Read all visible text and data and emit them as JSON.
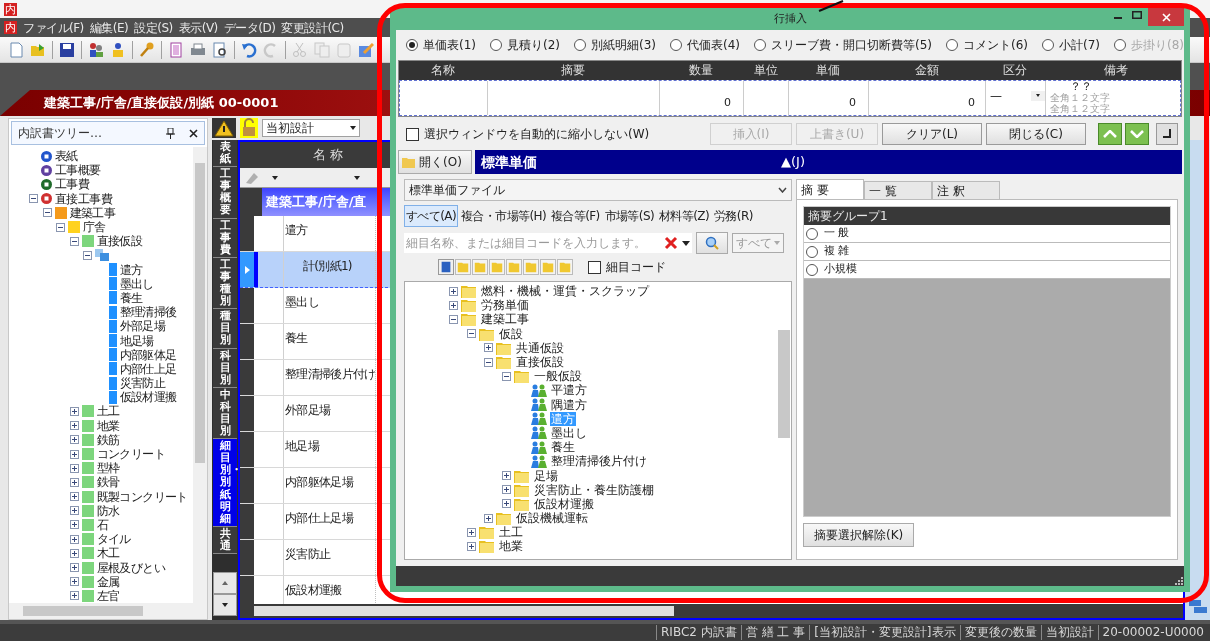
{
  "app": {
    "window_icon_text": "内",
    "menu_icon_text": "内",
    "menu": [
      "ファイル(F)",
      "編集(E)",
      "設定(S)",
      "表示(V)",
      "データ(D)",
      "変更設計(C)"
    ]
  },
  "breadcrumb_banner": "建築工事/庁舎/直接仮設/別紙 00-0001",
  "tree_panel": {
    "title": "内訳書ツリー…",
    "nodes": [
      {
        "label": "表紙",
        "kind": "badge",
        "color": "#2255cc"
      },
      {
        "label": "工事概要",
        "kind": "badge",
        "color": "#6040a0"
      },
      {
        "label": "工事費",
        "kind": "badge",
        "color": "#1f6b2a"
      },
      {
        "label": "直接工事費",
        "kind": "badge",
        "color": "#d03030",
        "expanded": true,
        "children": [
          {
            "label": "建築工事",
            "kind": "page",
            "color": "#f59a1b",
            "expanded": true,
            "children": [
              {
                "label": "庁舎",
                "kind": "page",
                "color": "#ffd21f",
                "expanded": true,
                "children": [
                  {
                    "label": "直接仮設",
                    "kind": "page",
                    "color": "#7dd67d",
                    "expanded": true,
                    "children": [
                      {
                        "kind": "group",
                        "color": "#3b8fe0",
                        "expanded": true,
                        "children": [
                          {
                            "label": "遣方",
                            "kind": "sheet",
                            "color": "#1e90ff"
                          },
                          {
                            "label": "墨出し",
                            "kind": "sheet",
                            "color": "#1e90ff"
                          },
                          {
                            "label": "養生",
                            "kind": "sheet",
                            "color": "#1e90ff"
                          },
                          {
                            "label": "整理清掃後",
                            "kind": "sheet",
                            "color": "#1e90ff"
                          },
                          {
                            "label": "外部足場",
                            "kind": "sheet",
                            "color": "#1e90ff"
                          },
                          {
                            "label": "地足場",
                            "kind": "sheet",
                            "color": "#1e90ff"
                          },
                          {
                            "label": "内部躯体足",
                            "kind": "sheet",
                            "color": "#1e90ff"
                          },
                          {
                            "label": "内部仕上足",
                            "kind": "sheet",
                            "color": "#1e90ff"
                          },
                          {
                            "label": "災害防止",
                            "kind": "sheet",
                            "color": "#1e90ff"
                          },
                          {
                            "label": "仮設材運搬",
                            "kind": "sheet",
                            "color": "#1e90ff"
                          }
                        ]
                      }
                    ]
                  },
                  {
                    "label": "土工",
                    "kind": "page",
                    "color": "#7dd67d",
                    "expanded": false
                  },
                  {
                    "label": "地業",
                    "kind": "page",
                    "color": "#7dd67d",
                    "expanded": false
                  },
                  {
                    "label": "鉄筋",
                    "kind": "page",
                    "color": "#7dd67d",
                    "expanded": false
                  },
                  {
                    "label": "コンクリート",
                    "kind": "page",
                    "color": "#7dd67d",
                    "expanded": false
                  },
                  {
                    "label": "型枠",
                    "kind": "page",
                    "color": "#7dd67d",
                    "expanded": false
                  },
                  {
                    "label": "鉄骨",
                    "kind": "page",
                    "color": "#7dd67d",
                    "expanded": false
                  },
                  {
                    "label": "既製コンクリート",
                    "kind": "page",
                    "color": "#7dd67d",
                    "expanded": false
                  },
                  {
                    "label": "防水",
                    "kind": "page",
                    "color": "#7dd67d",
                    "expanded": false
                  },
                  {
                    "label": "石",
                    "kind": "page",
                    "color": "#7dd67d",
                    "expanded": false
                  },
                  {
                    "label": "タイル",
                    "kind": "page",
                    "color": "#7dd67d",
                    "expanded": false
                  },
                  {
                    "label": "木工",
                    "kind": "page",
                    "color": "#7dd67d",
                    "expanded": false
                  },
                  {
                    "label": "屋根及びとい",
                    "kind": "page",
                    "color": "#7dd67d",
                    "expanded": false
                  },
                  {
                    "label": "金属",
                    "kind": "page",
                    "color": "#7dd67d",
                    "expanded": false
                  },
                  {
                    "label": "左官",
                    "kind": "page",
                    "color": "#7dd67d",
                    "expanded": false
                  }
                ]
              }
            ]
          }
        ]
      }
    ]
  },
  "view_tabs": [
    {
      "label": "表紙",
      "selected": false
    },
    {
      "label": "工事概要",
      "selected": false
    },
    {
      "label": "工事費",
      "selected": false
    },
    {
      "label": "工事種別",
      "selected": false
    },
    {
      "label": "種目別",
      "selected": false
    },
    {
      "label": "科目別",
      "selected": false
    },
    {
      "label": "中科目別",
      "selected": false
    },
    {
      "label": "細目別・別紙明細",
      "selected": true
    },
    {
      "label": "共通",
      "selected": false
    }
  ],
  "sheet": {
    "design_mode": "当初設計",
    "column_header": "名 称",
    "group_row": "建築工事/庁舎/直",
    "rows": [
      {
        "name": "遣方",
        "selected": false
      },
      {
        "name": "計(別紙1)",
        "selected": true,
        "kind": "subtotal"
      },
      {
        "name": "墨出し",
        "selected": false
      },
      {
        "name": "養生",
        "selected": false
      },
      {
        "name": "整理清掃後片付け",
        "selected": false
      },
      {
        "name": "外部足場",
        "selected": false
      },
      {
        "name": "地足場",
        "selected": false
      },
      {
        "name": "内部躯体足場",
        "selected": false
      },
      {
        "name": "内部仕上足場",
        "selected": false
      },
      {
        "name": "災害防止",
        "selected": false
      },
      {
        "name": "仮設材運搬",
        "selected": false
      }
    ]
  },
  "insert_dialog": {
    "title": "行挿入",
    "row_types": [
      {
        "label": "単価表(1)",
        "selected": true,
        "disabled": false
      },
      {
        "label": "見積り(2)",
        "selected": false,
        "disabled": false
      },
      {
        "label": "別紙明細(3)",
        "selected": false,
        "disabled": false
      },
      {
        "label": "代価表(4)",
        "selected": false,
        "disabled": false
      },
      {
        "label": "スリーブ費・開口切断費等(5)",
        "selected": false,
        "disabled": false
      },
      {
        "label": "コメント(6)",
        "selected": false,
        "disabled": false
      },
      {
        "label": "小計(7)",
        "selected": false,
        "disabled": false
      },
      {
        "label": "歩掛り(8)",
        "selected": false,
        "disabled": true
      }
    ],
    "entry": {
      "columns": [
        "名称",
        "摘要",
        "数量",
        "単位",
        "単価",
        "金額",
        "区分",
        "備考"
      ],
      "quantity": "0",
      "unit_price": "0",
      "amount": "0",
      "category": "—",
      "remarks": "？？",
      "remark_hints": [
        "全角１２文字",
        "全角１２文字"
      ]
    },
    "auto_shrink_checkbox": {
      "label": "選択ウィンドウを自動的に縮小しない(W)",
      "checked": false
    },
    "buttons": [
      {
        "label": "挿入(I)",
        "disabled": true
      },
      {
        "label": "上書き(U)",
        "disabled": true
      },
      {
        "label": "クリア(L)",
        "disabled": false
      },
      {
        "label": "閉じる(C)",
        "disabled": false
      }
    ],
    "open_button": "開く(O)",
    "source_title": "標準単価",
    "collapse_label": "▲(J)",
    "file_select": "標準単価ファイル",
    "filter_tabs": [
      {
        "label": "すべて(A)",
        "selected": true
      },
      {
        "label": "複合・市場等(H)",
        "selected": false
      },
      {
        "label": "複合等(F)",
        "selected": false
      },
      {
        "label": "市場等(S)",
        "selected": false
      },
      {
        "label": "材料等(Z)",
        "selected": false
      },
      {
        "label": "労務(R)",
        "selected": false
      }
    ],
    "search": {
      "placeholder": "細目名称、または細目コードを入力します。",
      "scope": "すべて"
    },
    "code_checkbox": {
      "label": "細目コード",
      "checked": false
    },
    "tree": [
      {
        "label": "燃料・機械・運賃・スクラップ",
        "kind": "folder",
        "expanded": false
      },
      {
        "label": "労務単価",
        "kind": "folder",
        "expanded": false
      },
      {
        "label": "建築工事",
        "kind": "folder",
        "expanded": true,
        "children": [
          {
            "label": "仮設",
            "kind": "folder",
            "expanded": true,
            "children": [
              {
                "label": "共通仮設",
                "kind": "folder",
                "expanded": false
              },
              {
                "label": "直接仮設",
                "kind": "folder",
                "expanded": true,
                "children": [
                  {
                    "label": "一般仮設",
                    "kind": "folder",
                    "expanded": true,
                    "children": [
                      {
                        "label": "平遣方",
                        "kind": "item",
                        "selected": false
                      },
                      {
                        "label": "隅遣方",
                        "kind": "item",
                        "selected": false
                      },
                      {
                        "label": "遣方",
                        "kind": "item",
                        "selected": true
                      },
                      {
                        "label": "墨出し",
                        "kind": "item",
                        "selected": false
                      },
                      {
                        "label": "養生",
                        "kind": "item",
                        "selected": false
                      },
                      {
                        "label": "整理清掃後片付け",
                        "kind": "item",
                        "selected": false
                      }
                    ]
                  },
                  {
                    "label": "足場",
                    "kind": "folder",
                    "expanded": false
                  },
                  {
                    "label": "災害防止・養生防護棚",
                    "kind": "folder",
                    "expanded": false
                  },
                  {
                    "label": "仮設材運搬",
                    "kind": "folder",
                    "expanded": false
                  }
                ]
              },
              {
                "label": "仮設機械運転",
                "kind": "folder",
                "expanded": false
              }
            ]
          },
          {
            "label": "土工",
            "kind": "folder",
            "expanded": false
          },
          {
            "label": "地業",
            "kind": "folder",
            "expanded": false
          }
        ]
      }
    ],
    "side_tabs": [
      {
        "label": "摘 要",
        "selected": true
      },
      {
        "label": "一 覧",
        "selected": false
      },
      {
        "label": "注 釈",
        "selected": false
      }
    ],
    "summary_group": {
      "title": "摘要グループ1",
      "options": [
        {
          "label": "一 般",
          "selected": false
        },
        {
          "label": "複 雑",
          "selected": false
        },
        {
          "label": "小規模",
          "selected": false
        }
      ]
    },
    "clear_summary_button": "摘要選択解除(K)"
  },
  "status_bar": [
    "RIBC2 内訳書",
    "営 繕 工 事",
    "[当初設計・変更設計]表示",
    "変更後の数量",
    "当初設計",
    "20-00002-U0000"
  ]
}
